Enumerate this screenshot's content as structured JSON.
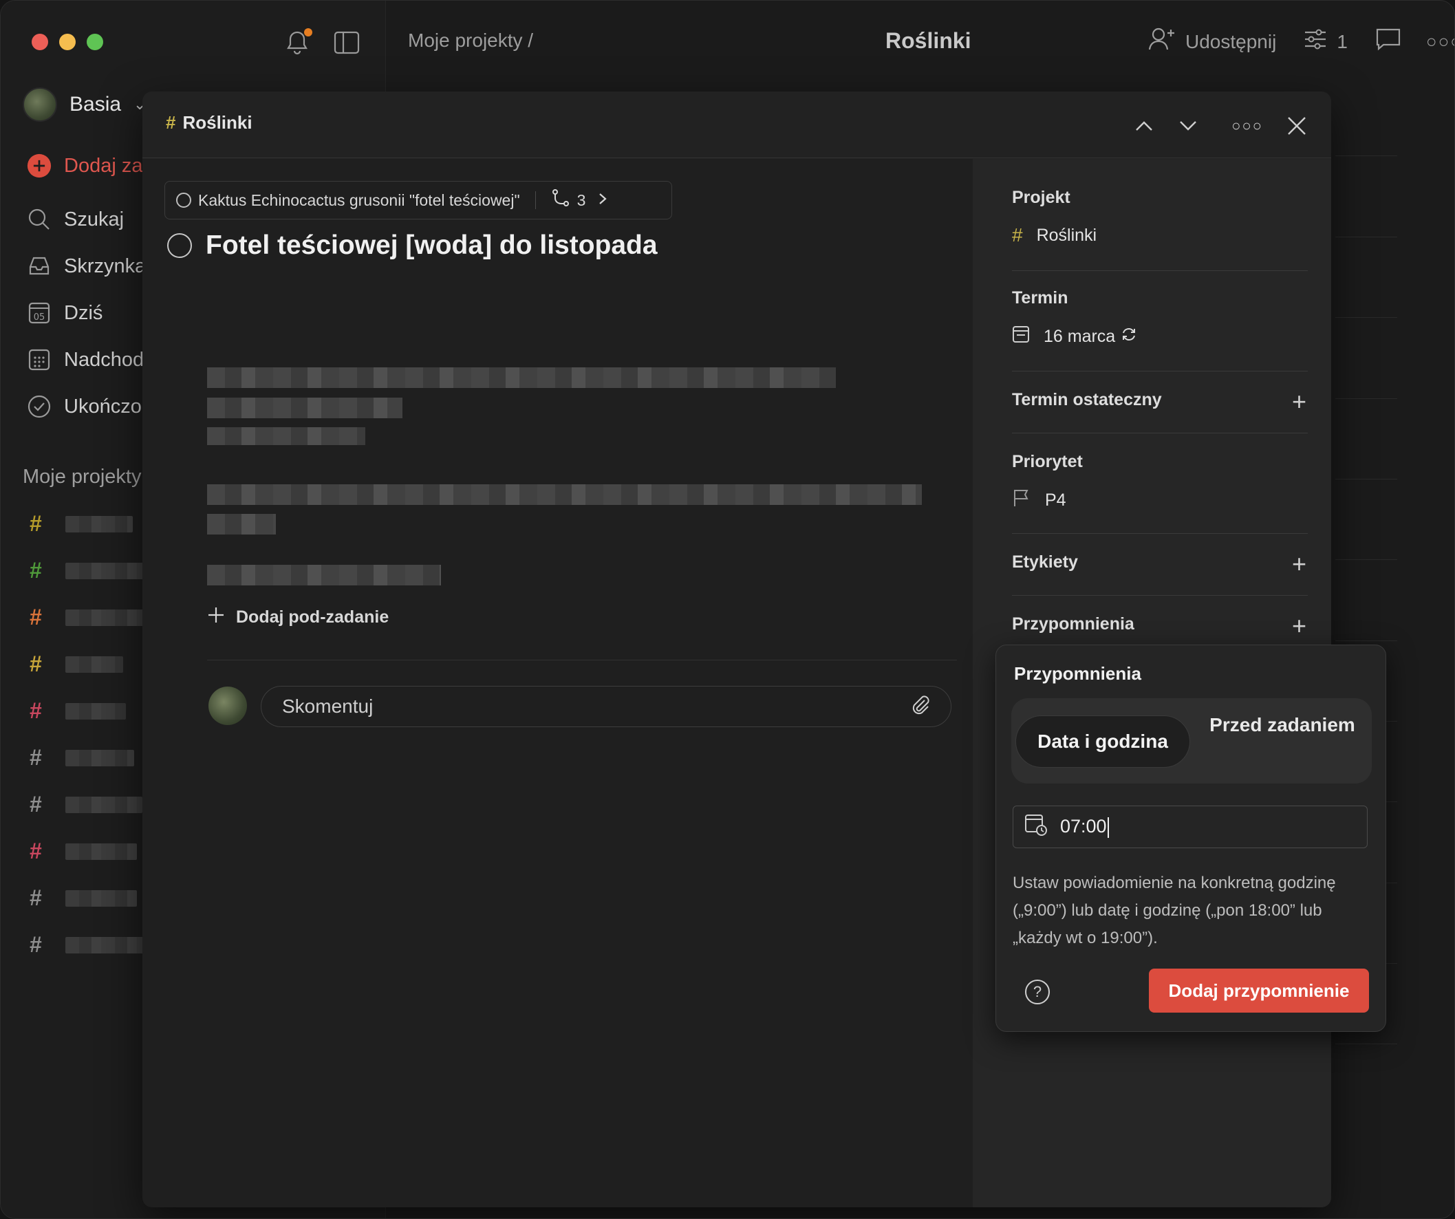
{
  "sidebar": {
    "user": "Basia",
    "nav": [
      "Dodaj za",
      "Szukaj",
      "Skrzynka",
      "Dziś",
      "Nadchod",
      "Ukończo"
    ],
    "calendar_day": "05",
    "section": "Moje projekty",
    "project_colors": [
      "#b59c2b",
      "#4f9a3a",
      "#d9733a",
      "#c7a53a",
      "#c8475e",
      "#8e8e8e",
      "#8e8e8e",
      "#c8475e",
      "#8e8e8e",
      "#8e8e8e"
    ]
  },
  "topbar": {
    "breadcrumb": "Moje projekty /",
    "title": "Roślinki",
    "share": "Udostępnij",
    "filter_count": "1"
  },
  "modal": {
    "project": "Roślinki",
    "parent_task": "Kaktus Echinocactus grusonii \"fotel teściowej\"",
    "subtask_count": "3",
    "task_title": "Fotel teściowej [woda] do listopada",
    "add_subtask": "Dodaj pod-zadanie",
    "comment_placeholder": "Skomentuj"
  },
  "details": {
    "project_label": "Projekt",
    "project_value": "Roślinki",
    "due_label": "Termin",
    "due_value": "16 marca",
    "deadline_label": "Termin ostateczny",
    "priority_label": "Priorytet",
    "priority_value": "P4",
    "labels_label": "Etykiety",
    "reminders_label": "Przypomnienia"
  },
  "reminders_popover": {
    "title": "Przypomnienia",
    "tab_active": "Data i godzina",
    "tab_inactive": "Przed zadaniem",
    "time_value": "07:00",
    "help_text": "Ustaw powiadomienie na konkretną godzinę („9:00”) lub datę i godzinę („pon 18:00” lub „każdy wt o 19:00”).",
    "add_button": "Dodaj przypomnienie",
    "accent_color": "#dc4c3e"
  }
}
